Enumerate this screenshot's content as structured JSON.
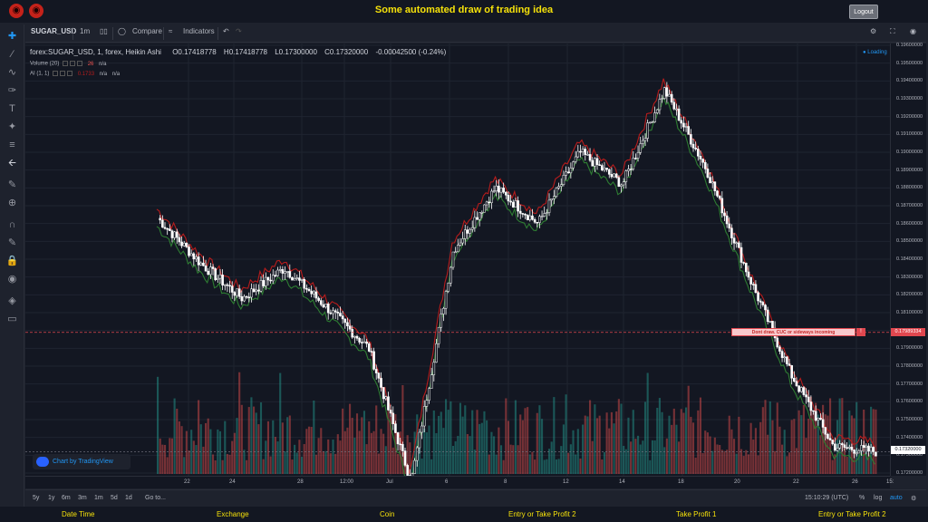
{
  "app": {
    "title": "Some automated draw of trading idea",
    "logout_label": "Logout"
  },
  "toolbar": {
    "symbol": "SUGAR_USD",
    "interval": "1m",
    "compare_label": "Compare",
    "indicators_label": "Indicators"
  },
  "legend": {
    "title": "forex:SUGAR_USD, 1, forex, Heikin Ashi",
    "open": "O0.17418778",
    "high": "H0.17418778",
    "low": "L0.17300000",
    "close": "C0.17320000",
    "change": "-0.00042500 (-0.24%)",
    "volume_label": "Volume (20)",
    "volume_value": "26",
    "volume_na": "n/a",
    "ai_label": "AI (1, 1)",
    "ai_value1": "0.1733",
    "ai_na1": "n/a",
    "ai_na2": "n/a",
    "loading": "Loading"
  },
  "price_scale": {
    "ticks": [
      "0.19600000",
      "0.19500000",
      "0.19400000",
      "0.19300000",
      "0.19200000",
      "0.19100000",
      "0.19000000",
      "0.18900000",
      "0.18800000",
      "0.18700000",
      "0.18600000",
      "0.18500000",
      "0.18400000",
      "0.18300000",
      "0.18200000",
      "0.18100000",
      "0.18000000",
      "0.17900000",
      "0.17800000",
      "0.17700000",
      "0.17600000",
      "0.17500000",
      "0.17400000",
      "0.17300000",
      "0.17200000"
    ],
    "alert_price": "0.17989334",
    "current_price": "0.17320000"
  },
  "time_axis": {
    "ticks": [
      "22",
      "24",
      "28",
      "12:00",
      "Jul",
      "6",
      "8",
      "12",
      "14",
      "18",
      "20",
      "22",
      "26",
      "15:"
    ]
  },
  "alert": {
    "text": "Dont draw. CUC or sideways incoming",
    "mark": "!"
  },
  "badge": {
    "label": "Chart by TradingView"
  },
  "bottom": {
    "ranges": [
      "5y",
      "1y",
      "6m",
      "3m",
      "1m",
      "5d",
      "1d"
    ],
    "goto_label": "Go to...",
    "clock": "15:10:29 (UTC)",
    "pct": "%",
    "log": "log",
    "auto": "auto"
  },
  "footer": {
    "items": [
      "Date Time",
      "Exchange",
      "Coin",
      "Entry or Take Profit 2",
      "Take Profit 1",
      "Entry or Take Profit 2"
    ]
  },
  "colors": {
    "accent_yellow": "#f5e10a",
    "up_volume": "#26a69a",
    "down_volume": "#ef5350",
    "candle": "#ffffff",
    "upper_band": "#b71c1c",
    "lower_band": "#2e7d32",
    "alert_line": "#e0474f",
    "current_price_bg": "#ffffff"
  },
  "chart_data": {
    "type": "line",
    "style": "Heikin Ashi candles with volume",
    "x": [
      "22",
      "24",
      "28",
      "Jul",
      "6",
      "8",
      "12",
      "14",
      "18",
      "20",
      "22",
      "26"
    ],
    "series": [
      {
        "values": [
          0.1863,
          0.1838,
          0.1818,
          0.1835,
          0.1813,
          0.179,
          0.1715,
          0.1845,
          0.188,
          0.186,
          0.19,
          0.1882,
          0.1935,
          0.189,
          0.183,
          0.1775,
          0.1735,
          0.1732
        ]
      }
    ],
    "ylim": [
      0.172,
      0.196
    ],
    "grid": true
  }
}
